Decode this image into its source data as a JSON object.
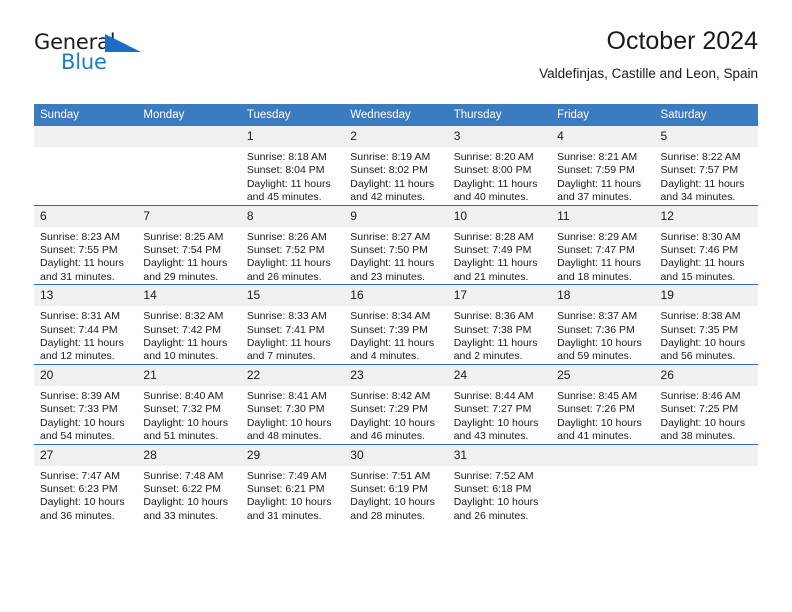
{
  "brand": {
    "name_top": "General",
    "name_bottom": "Blue",
    "accent_color": "#1b6ec2"
  },
  "header": {
    "title": "October 2024",
    "subtitle": "Valdefinjas, Castille and Leon, Spain"
  },
  "calendar": {
    "header_bg": "#3b7cc0",
    "daynum_bg": "#f0f0f0",
    "weekday_headers": [
      "Sunday",
      "Monday",
      "Tuesday",
      "Wednesday",
      "Thursday",
      "Friday",
      "Saturday"
    ],
    "weeks": [
      [
        {
          "day": "",
          "lines": []
        },
        {
          "day": "",
          "lines": []
        },
        {
          "day": "1",
          "lines": [
            "Sunrise: 8:18 AM",
            "Sunset: 8:04 PM",
            "Daylight: 11 hours",
            "and 45 minutes."
          ]
        },
        {
          "day": "2",
          "lines": [
            "Sunrise: 8:19 AM",
            "Sunset: 8:02 PM",
            "Daylight: 11 hours",
            "and 42 minutes."
          ]
        },
        {
          "day": "3",
          "lines": [
            "Sunrise: 8:20 AM",
            "Sunset: 8:00 PM",
            "Daylight: 11 hours",
            "and 40 minutes."
          ]
        },
        {
          "day": "4",
          "lines": [
            "Sunrise: 8:21 AM",
            "Sunset: 7:59 PM",
            "Daylight: 11 hours",
            "and 37 minutes."
          ]
        },
        {
          "day": "5",
          "lines": [
            "Sunrise: 8:22 AM",
            "Sunset: 7:57 PM",
            "Daylight: 11 hours",
            "and 34 minutes."
          ]
        }
      ],
      [
        {
          "day": "6",
          "lines": [
            "Sunrise: 8:23 AM",
            "Sunset: 7:55 PM",
            "Daylight: 11 hours",
            "and 31 minutes."
          ]
        },
        {
          "day": "7",
          "lines": [
            "Sunrise: 8:25 AM",
            "Sunset: 7:54 PM",
            "Daylight: 11 hours",
            "and 29 minutes."
          ]
        },
        {
          "day": "8",
          "lines": [
            "Sunrise: 8:26 AM",
            "Sunset: 7:52 PM",
            "Daylight: 11 hours",
            "and 26 minutes."
          ]
        },
        {
          "day": "9",
          "lines": [
            "Sunrise: 8:27 AM",
            "Sunset: 7:50 PM",
            "Daylight: 11 hours",
            "and 23 minutes."
          ]
        },
        {
          "day": "10",
          "lines": [
            "Sunrise: 8:28 AM",
            "Sunset: 7:49 PM",
            "Daylight: 11 hours",
            "and 21 minutes."
          ]
        },
        {
          "day": "11",
          "lines": [
            "Sunrise: 8:29 AM",
            "Sunset: 7:47 PM",
            "Daylight: 11 hours",
            "and 18 minutes."
          ]
        },
        {
          "day": "12",
          "lines": [
            "Sunrise: 8:30 AM",
            "Sunset: 7:46 PM",
            "Daylight: 11 hours",
            "and 15 minutes."
          ]
        }
      ],
      [
        {
          "day": "13",
          "lines": [
            "Sunrise: 8:31 AM",
            "Sunset: 7:44 PM",
            "Daylight: 11 hours",
            "and 12 minutes."
          ]
        },
        {
          "day": "14",
          "lines": [
            "Sunrise: 8:32 AM",
            "Sunset: 7:42 PM",
            "Daylight: 11 hours",
            "and 10 minutes."
          ]
        },
        {
          "day": "15",
          "lines": [
            "Sunrise: 8:33 AM",
            "Sunset: 7:41 PM",
            "Daylight: 11 hours",
            "and 7 minutes."
          ]
        },
        {
          "day": "16",
          "lines": [
            "Sunrise: 8:34 AM",
            "Sunset: 7:39 PM",
            "Daylight: 11 hours",
            "and 4 minutes."
          ]
        },
        {
          "day": "17",
          "lines": [
            "Sunrise: 8:36 AM",
            "Sunset: 7:38 PM",
            "Daylight: 11 hours",
            "and 2 minutes."
          ]
        },
        {
          "day": "18",
          "lines": [
            "Sunrise: 8:37 AM",
            "Sunset: 7:36 PM",
            "Daylight: 10 hours",
            "and 59 minutes."
          ]
        },
        {
          "day": "19",
          "lines": [
            "Sunrise: 8:38 AM",
            "Sunset: 7:35 PM",
            "Daylight: 10 hours",
            "and 56 minutes."
          ]
        }
      ],
      [
        {
          "day": "20",
          "lines": [
            "Sunrise: 8:39 AM",
            "Sunset: 7:33 PM",
            "Daylight: 10 hours",
            "and 54 minutes."
          ]
        },
        {
          "day": "21",
          "lines": [
            "Sunrise: 8:40 AM",
            "Sunset: 7:32 PM",
            "Daylight: 10 hours",
            "and 51 minutes."
          ]
        },
        {
          "day": "22",
          "lines": [
            "Sunrise: 8:41 AM",
            "Sunset: 7:30 PM",
            "Daylight: 10 hours",
            "and 48 minutes."
          ]
        },
        {
          "day": "23",
          "lines": [
            "Sunrise: 8:42 AM",
            "Sunset: 7:29 PM",
            "Daylight: 10 hours",
            "and 46 minutes."
          ]
        },
        {
          "day": "24",
          "lines": [
            "Sunrise: 8:44 AM",
            "Sunset: 7:27 PM",
            "Daylight: 10 hours",
            "and 43 minutes."
          ]
        },
        {
          "day": "25",
          "lines": [
            "Sunrise: 8:45 AM",
            "Sunset: 7:26 PM",
            "Daylight: 10 hours",
            "and 41 minutes."
          ]
        },
        {
          "day": "26",
          "lines": [
            "Sunrise: 8:46 AM",
            "Sunset: 7:25 PM",
            "Daylight: 10 hours",
            "and 38 minutes."
          ]
        }
      ],
      [
        {
          "day": "27",
          "lines": [
            "Sunrise: 7:47 AM",
            "Sunset: 6:23 PM",
            "Daylight: 10 hours",
            "and 36 minutes."
          ]
        },
        {
          "day": "28",
          "lines": [
            "Sunrise: 7:48 AM",
            "Sunset: 6:22 PM",
            "Daylight: 10 hours",
            "and 33 minutes."
          ]
        },
        {
          "day": "29",
          "lines": [
            "Sunrise: 7:49 AM",
            "Sunset: 6:21 PM",
            "Daylight: 10 hours",
            "and 31 minutes."
          ]
        },
        {
          "day": "30",
          "lines": [
            "Sunrise: 7:51 AM",
            "Sunset: 6:19 PM",
            "Daylight: 10 hours",
            "and 28 minutes."
          ]
        },
        {
          "day": "31",
          "lines": [
            "Sunrise: 7:52 AM",
            "Sunset: 6:18 PM",
            "Daylight: 10 hours",
            "and 26 minutes."
          ]
        },
        {
          "day": "",
          "lines": []
        },
        {
          "day": "",
          "lines": []
        }
      ]
    ]
  }
}
